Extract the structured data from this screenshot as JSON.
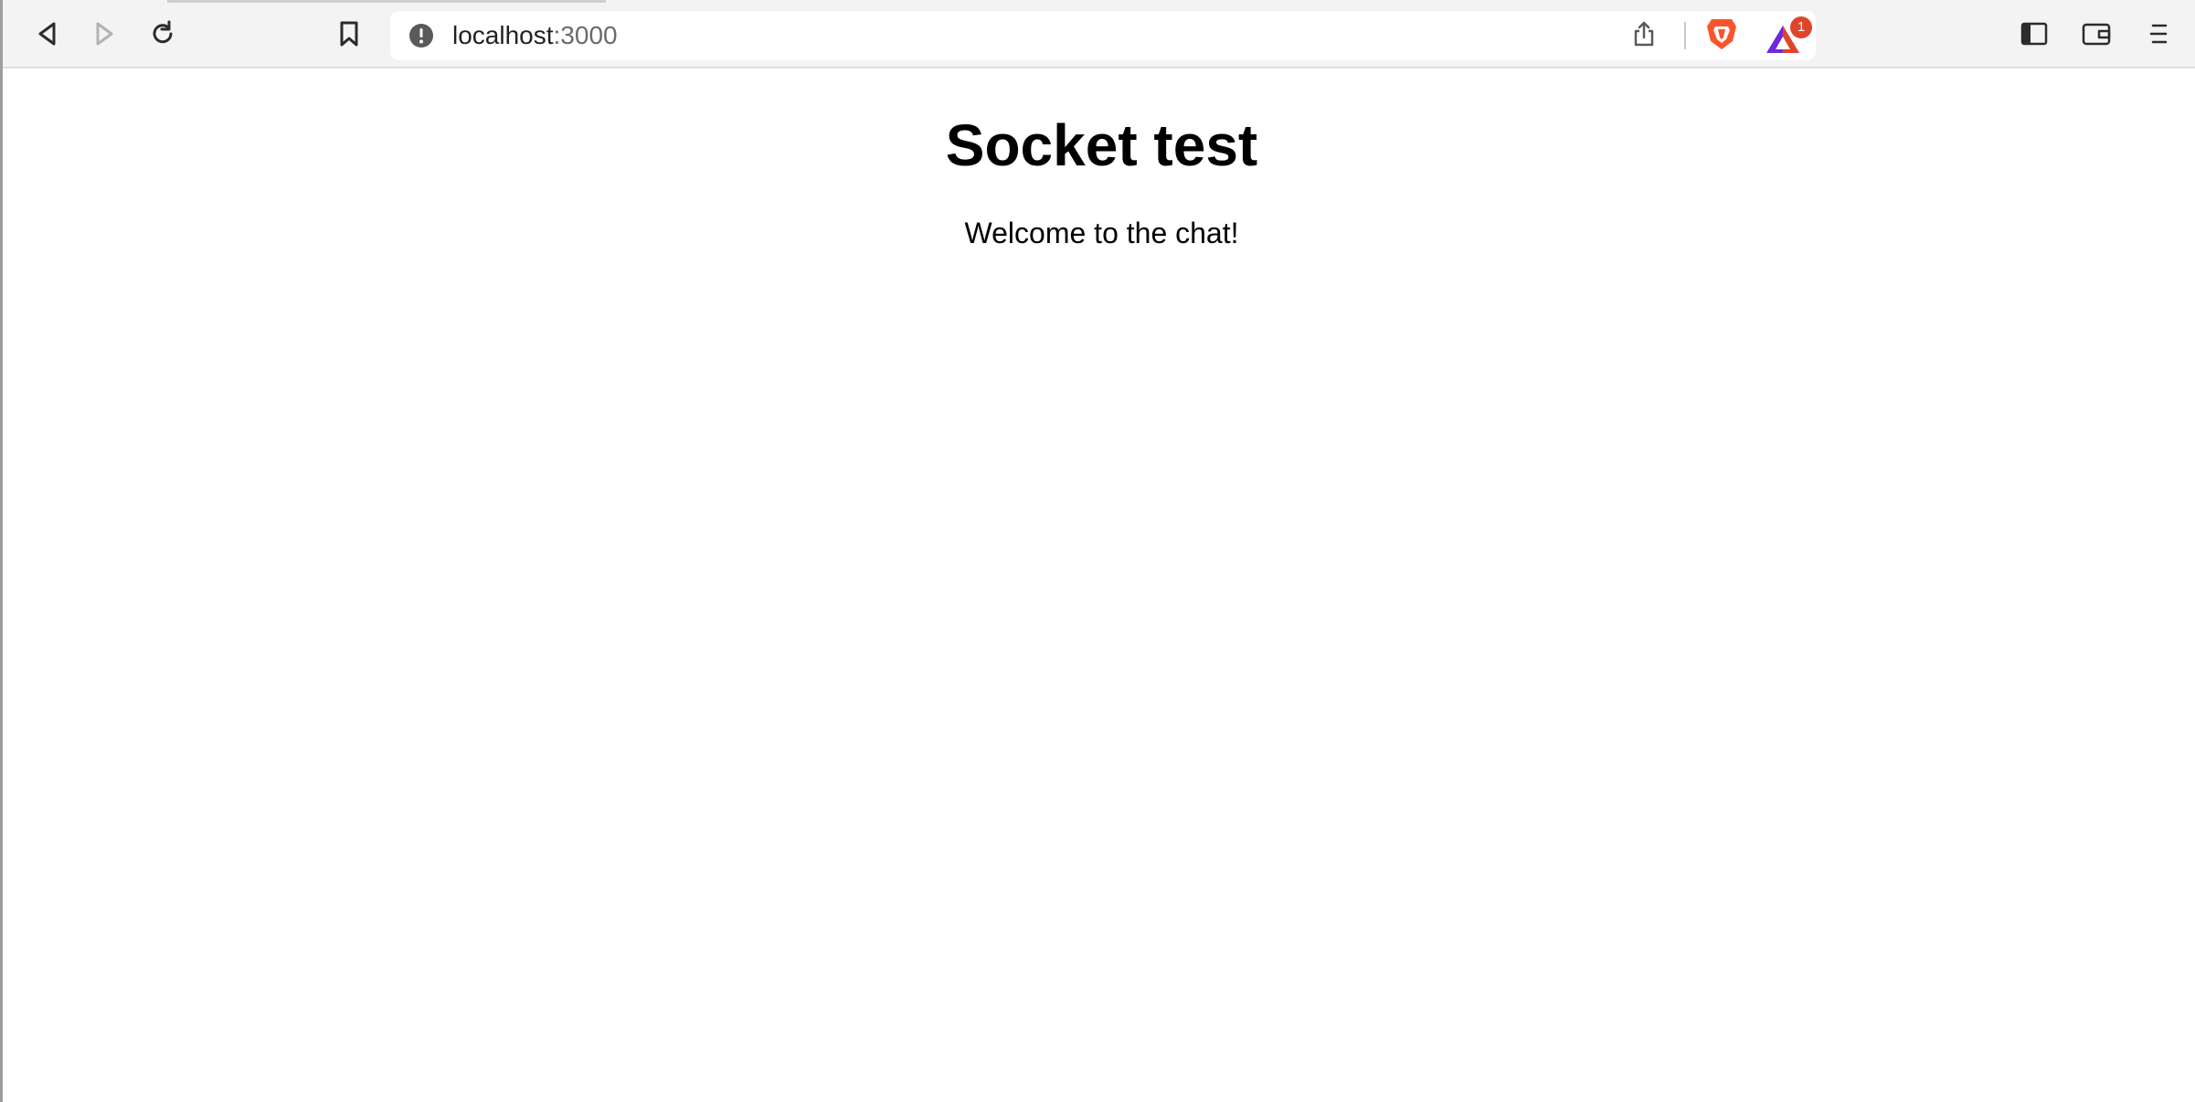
{
  "browser": {
    "address": {
      "host": "localhost",
      "port": ":3000"
    },
    "rewards_badge": "1",
    "icons": {
      "back": "back-arrow-icon",
      "forward": "forward-arrow-icon",
      "reload": "reload-icon",
      "bookmark": "bookmark-icon",
      "site_info": "site-info-icon",
      "share": "share-icon",
      "shields": "brave-shields-icon",
      "rewards": "brave-rewards-icon",
      "sidebar": "sidebar-icon",
      "wallet": "wallet-icon",
      "menu": "menu-icon"
    },
    "colors": {
      "toolbar_bg": "#f3f3f3",
      "shields_orange": "#fb542b",
      "rewards_badge_bg": "#e0452a"
    }
  },
  "page": {
    "title": "Socket test",
    "welcome_text": "Welcome to the chat!"
  }
}
